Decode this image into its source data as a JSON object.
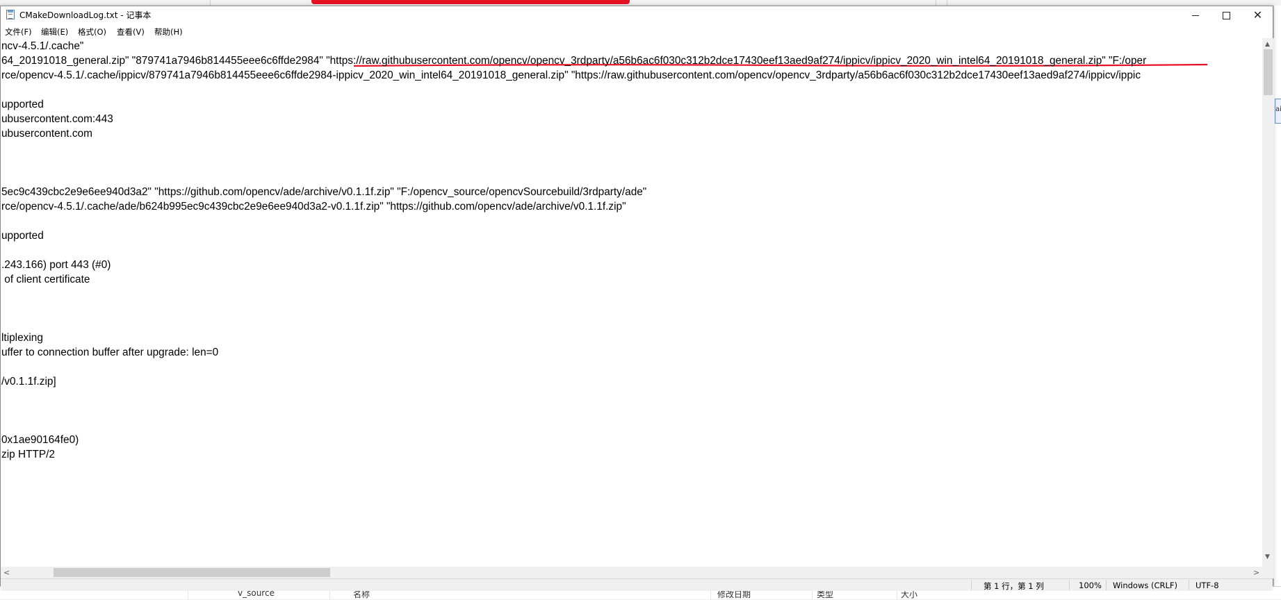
{
  "background_window": {
    "bottom_columns": [
      "v_source",
      "名称",
      "修改日期",
      "类型",
      "大小"
    ],
    "right_edge_glyph": "ai"
  },
  "window": {
    "title": "CMakeDownloadLog.txt - 记事本",
    "controls": {
      "minimize": "—",
      "maximize": "☐",
      "close": "✕"
    }
  },
  "menu": [
    "文件(F)",
    "编辑(E)",
    "格式(O)",
    "查看(V)",
    "帮助(H)"
  ],
  "editor": {
    "lines": [
      "ncv-4.5.1/.cache\"",
      "64_20191018_general.zip\" \"879741a7946b814455eee6c6ffde2984\" \"https://raw.githubusercontent.com/opencv/opencv_3rdparty/a56b6ac6f030c312b2dce17430eef13aed9af274/ippicv/ippicv_2020_win_intel64_20191018_general.zip\" \"F:/oper",
      "rce/opencv-4.5.1/.cache/ippicv/879741a7946b814455eee6c6ffde2984-ippicv_2020_win_intel64_20191018_general.zip\" \"https://raw.githubusercontent.com/opencv/opencv_3rdparty/a56b6ac6f030c312b2dce17430eef13aed9af274/ippicv/ippic",
      "",
      "upported",
      "ubusercontent.com:443",
      "ubusercontent.com",
      "",
      "",
      "",
      "5ec9c439cbc2e9e6ee940d3a2\" \"https://github.com/opencv/ade/archive/v0.1.1f.zip\" \"F:/opencv_source/opencvSourcebuild/3rdparty/ade\"",
      "rce/opencv-4.5.1/.cache/ade/b624b995ec9c439cbc2e9e6ee940d3a2-v0.1.1f.zip\" \"https://github.com/opencv/ade/archive/v0.1.1f.zip\"",
      "",
      "upported",
      "",
      ".243.166) port 443 (#0)",
      " of client certificate",
      "",
      "",
      "",
      "ltiplexing",
      "uffer to connection buffer after upgrade: len=0",
      "",
      "/v0.1.1f.zip]",
      "",
      "",
      "",
      "0x1ae90164fe0)",
      "zip HTTP/2"
    ]
  },
  "status": {
    "position": "第 1 行，第 1 列",
    "zoom": "100%",
    "line_ending": "Windows (CRLF)",
    "encoding": "UTF-8"
  },
  "colors": {
    "annotation_red": "#e81123",
    "window_bg": "#ffffff",
    "chrome_bg": "#f0f0f0"
  }
}
